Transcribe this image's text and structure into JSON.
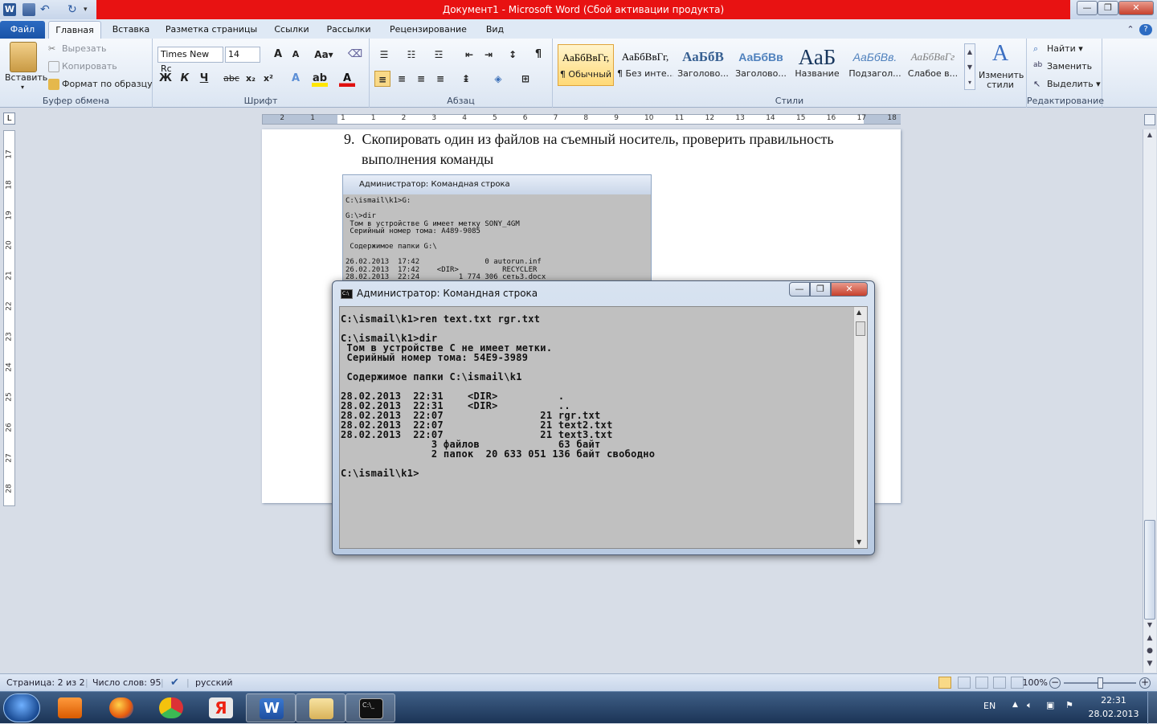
{
  "window": {
    "title": "Документ1 - Microsoft Word (Сбой активации продукта)"
  },
  "tabs": [
    "Файл",
    "Главная",
    "Вставка",
    "Разметка страницы",
    "Ссылки",
    "Рассылки",
    "Рецензирование",
    "Вид"
  ],
  "clipboard": {
    "paste": "Вставить",
    "cut": "Вырезать",
    "copy": "Копировать",
    "format_painter": "Формат по образцу",
    "group": "Буфер обмена"
  },
  "font": {
    "name": "Times New Rc",
    "size": "14",
    "bold": "Ж",
    "italic": "К",
    "underline": "Ч",
    "strike": "abc",
    "group": "Шрифт"
  },
  "paragraph": {
    "group": "Абзац"
  },
  "styles": {
    "items": [
      {
        "sample": "АаБбВвГг,",
        "label": "¶ Обычный"
      },
      {
        "sample": "АаБбВвГг,",
        "label": "¶ Без инте..."
      },
      {
        "sample": "АаБбВ",
        "label": "Заголово..."
      },
      {
        "sample": "АаБбВв",
        "label": "Заголово..."
      },
      {
        "sample": "АаБ",
        "label": "Название"
      },
      {
        "sample": "АаБбВв.",
        "label": "Подзагол..."
      },
      {
        "sample": "АаБбВвГг",
        "label": "Слабое в..."
      }
    ],
    "change": "Изменить стили",
    "group": "Стили"
  },
  "editing": {
    "find": "Найти",
    "replace": "Заменить",
    "select": "Выделить",
    "group": "Редактирование"
  },
  "document": {
    "item_number": "9.",
    "item_line1": "Скопировать один из файлов на съемный носитель, проверить правильность",
    "item_line2": "выполнения команды",
    "inner_title": "Администратор: Командная строка",
    "inner_console": "C:\\ismail\\k1>G:\n\nG:\\>dir\n Том в устройстве G имеет метку SONY_4GM\n Серийный номер тома: A489-9085\n\n Содержимое папки G:\\\n\n26.02.2013  17:42               0 autorun.inf\n26.02.2013  17:42    <DIR>          RECYCLER\n28.02.2013  22:24         1 774 306 сеть3.docx"
  },
  "cmd": {
    "title": "Администратор: Командная строка",
    "console": "C:\\ismail\\k1>ren text.txt rgr.txt\n\nC:\\ismail\\k1>dir\n Том в устройстве C не имеет метки.\n Серийный номер тома: 54E9-3989\n\n Содержимое папки C:\\ismail\\k1\n\n28.02.2013  22:31    <DIR>          .\n28.02.2013  22:31    <DIR>          ..\n28.02.2013  22:07                21 rgr.txt\n28.02.2013  22:07                21 text2.txt\n28.02.2013  22:07                21 text3.txt\n               3 файлов             63 байт\n               2 папок  20 633 051 136 байт свободно\n\nC:\\ismail\\k1>"
  },
  "status": {
    "page": "Страница: 2 из 2",
    "words": "Число слов: 95",
    "language": "русский",
    "zoom": "100%"
  },
  "tray": {
    "lang": "EN",
    "time": "22:31",
    "date": "28.02.2013"
  },
  "ruler_h": [
    "2",
    "1",
    "1",
    "1",
    "2",
    "3",
    "4",
    "5",
    "6",
    "7",
    "8",
    "9",
    "10",
    "11",
    "12",
    "13",
    "14",
    "15",
    "16",
    "17",
    "18"
  ],
  "ruler_v": [
    "17",
    "18",
    "19",
    "20",
    "21",
    "22",
    "23",
    "24",
    "25",
    "26",
    "27",
    "28"
  ]
}
